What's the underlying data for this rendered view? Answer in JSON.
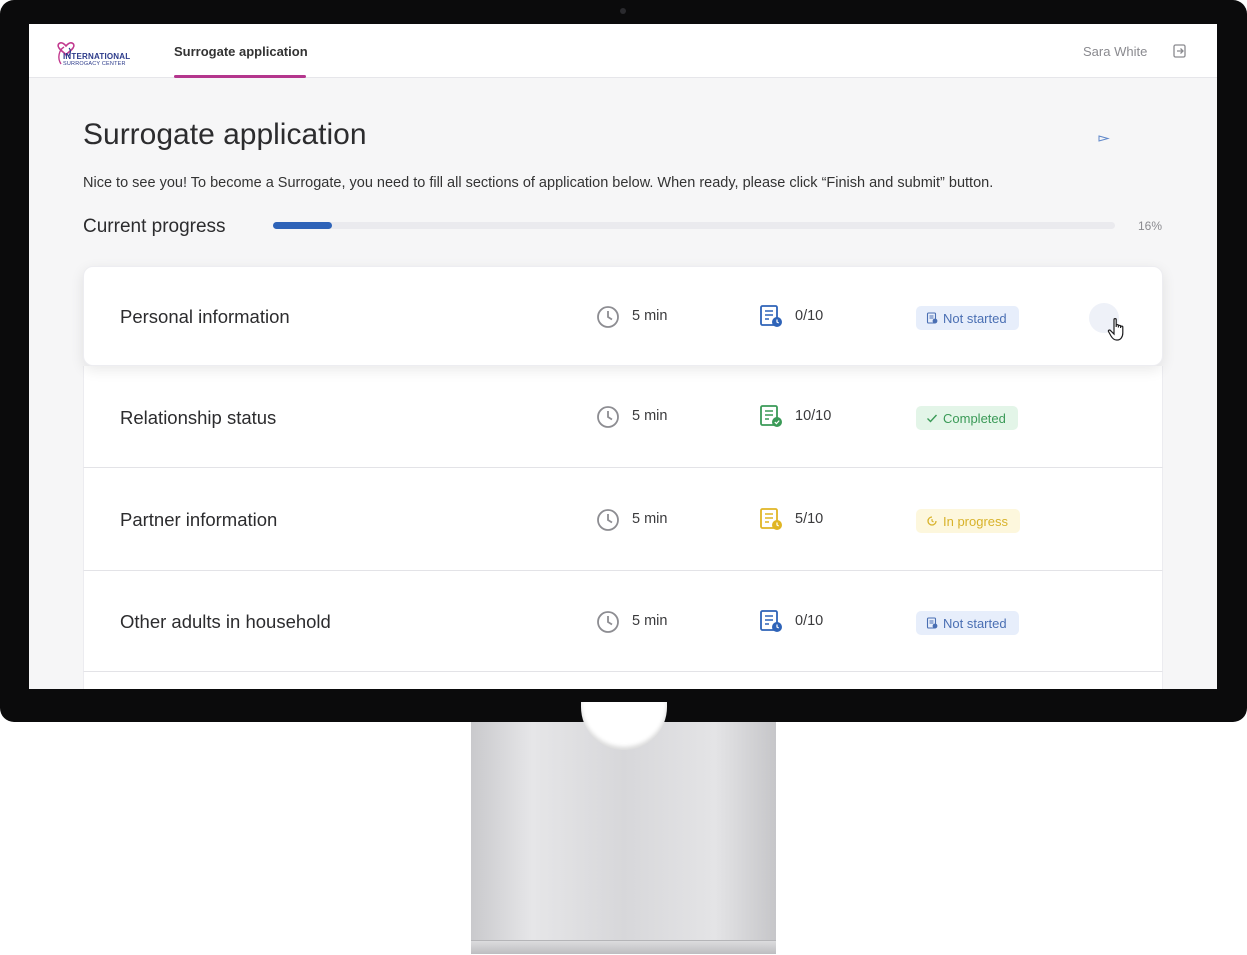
{
  "header": {
    "logo_line1": "INTERNATIONAL",
    "logo_line2": "SURROGACY CENTER",
    "nav_tab": "Surrogate application",
    "user_name": "Sara White",
    "logout_icon": "logout-icon"
  },
  "page": {
    "title": "Surrogate application",
    "intro": "Nice to see you! To become a Surrogate, you need to fill all sections of application below. When ready, please click “Finish and submit” button.",
    "progress_label": "Current progress",
    "progress_percent_text": "16%",
    "progress_fraction": 0.07
  },
  "colors": {
    "accent": "#2e63b8",
    "brand": "#b4368d",
    "not_started_bg": "#e7eefb",
    "not_started_fg": "#4a6fb3",
    "completed_bg": "#e3f5e8",
    "completed_fg": "#3a9a57",
    "in_progress_bg": "#fdf7dd",
    "in_progress_fg": "#d8b22a"
  },
  "sections": [
    {
      "title": "Personal information",
      "time": "5 min",
      "count": "0/10",
      "status": "Not started",
      "status_kind": "not_started",
      "doc_icon": "document-clock-icon"
    },
    {
      "title": "Relationship status",
      "time": "5 min",
      "count": "10/10",
      "status": "Completed",
      "status_kind": "completed",
      "doc_icon": "document-check-icon"
    },
    {
      "title": "Partner information",
      "time": "5 min",
      "count": "5/10",
      "status": "In progress",
      "status_kind": "in_progress",
      "doc_icon": "document-progress-icon"
    },
    {
      "title": "Other adults in household",
      "time": "5 min",
      "count": "0/10",
      "status": "Not started",
      "status_kind": "not_started",
      "doc_icon": "document-clock-icon"
    }
  ]
}
